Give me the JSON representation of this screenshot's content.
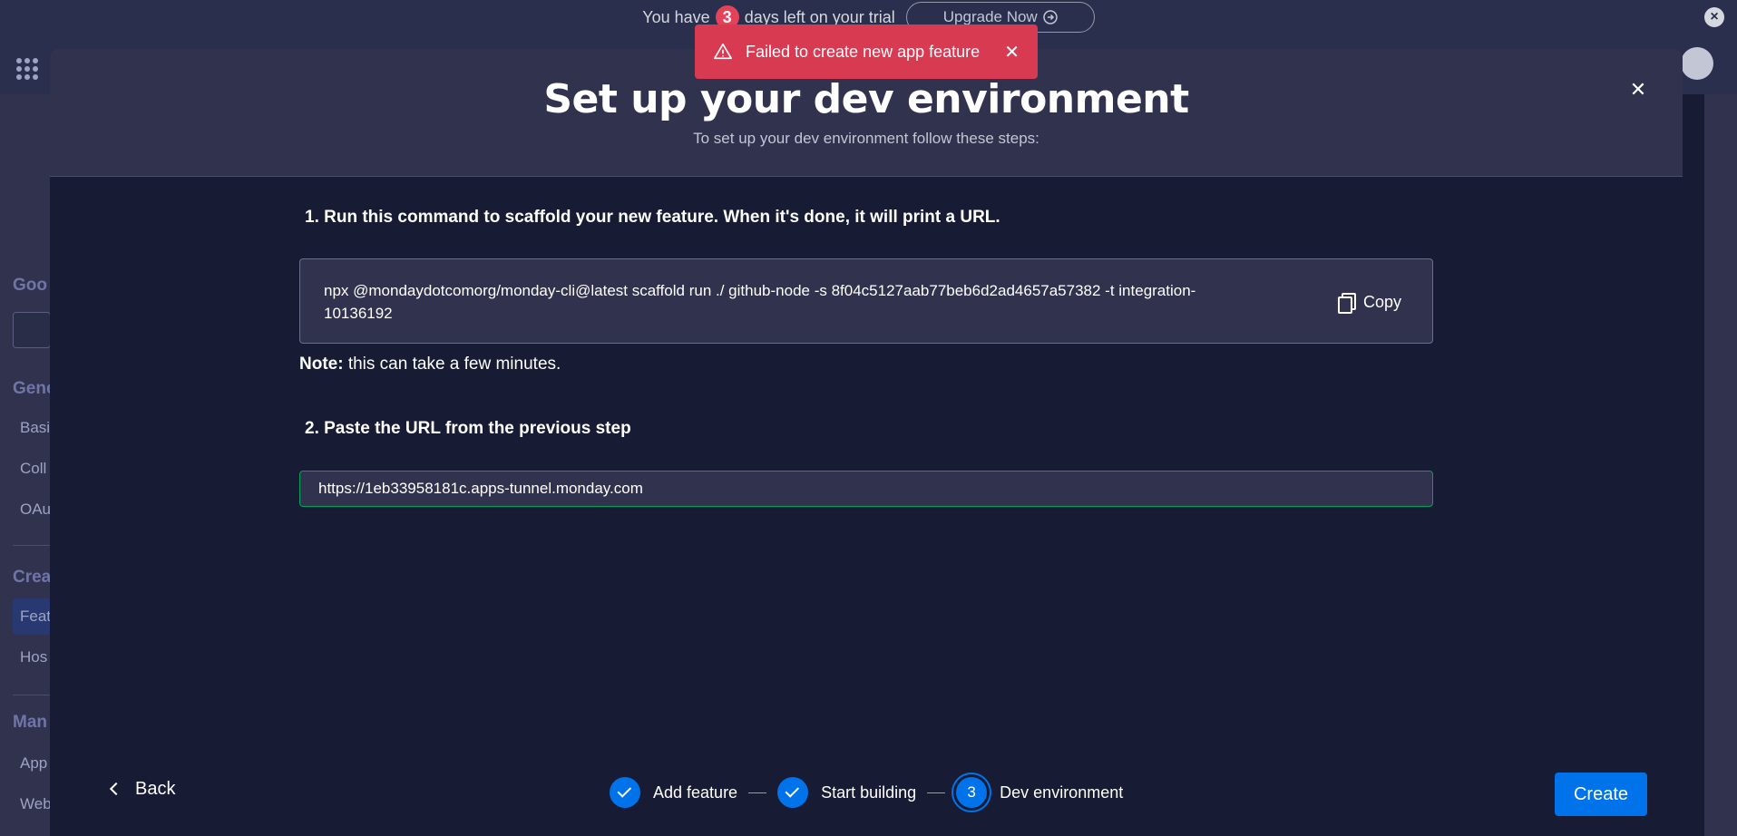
{
  "trial": {
    "prefix": "You have",
    "days": "3",
    "suffix": "days left on your trial",
    "upgrade_label": "Upgrade Now",
    "upgrade_icon": "arrow-right-circle-icon",
    "close_icon": "close-icon"
  },
  "background": {
    "sidebar": {
      "heading_goo": "Goo",
      "heading_gene": "Gene",
      "item_basi": "Basi",
      "item_coll": "Coll",
      "item_oau": "OAu",
      "heading_crea": "Crea",
      "item_feat": "Feat",
      "item_hos": "Hos",
      "heading_man": "Man",
      "item_app": "App",
      "item_web": "Web"
    }
  },
  "toast": {
    "message": "Failed to create new app feature",
    "icon": "warning-icon",
    "color": "#d83a52"
  },
  "modal": {
    "title": "Set up your dev environment",
    "subtitle": "To set up your dev environment follow these steps:",
    "step1_title": "1. Run this command to scaffold your new feature. When it's done, it will print a URL.",
    "command": "npx @mondaydotcomorg/monday-cli@latest scaffold run ./ github-node -s 8f04c5127aab77beb6d2ad4657a57382 -t integration-10136192",
    "copy_label": "Copy",
    "note_label": "Note:",
    "note_text": " this can take a few minutes.",
    "step2_title": "2. Paste the URL from the previous step",
    "url_value": "https://1eb33958181c.apps-tunnel.monday.com"
  },
  "footer": {
    "back_label": "Back",
    "steps": [
      {
        "label": "Add feature",
        "state": "done"
      },
      {
        "label": "Start building",
        "state": "done"
      },
      {
        "label": "Dev environment",
        "state": "current",
        "number": "3"
      }
    ],
    "create_label": "Create",
    "accent": "#0073ea"
  }
}
